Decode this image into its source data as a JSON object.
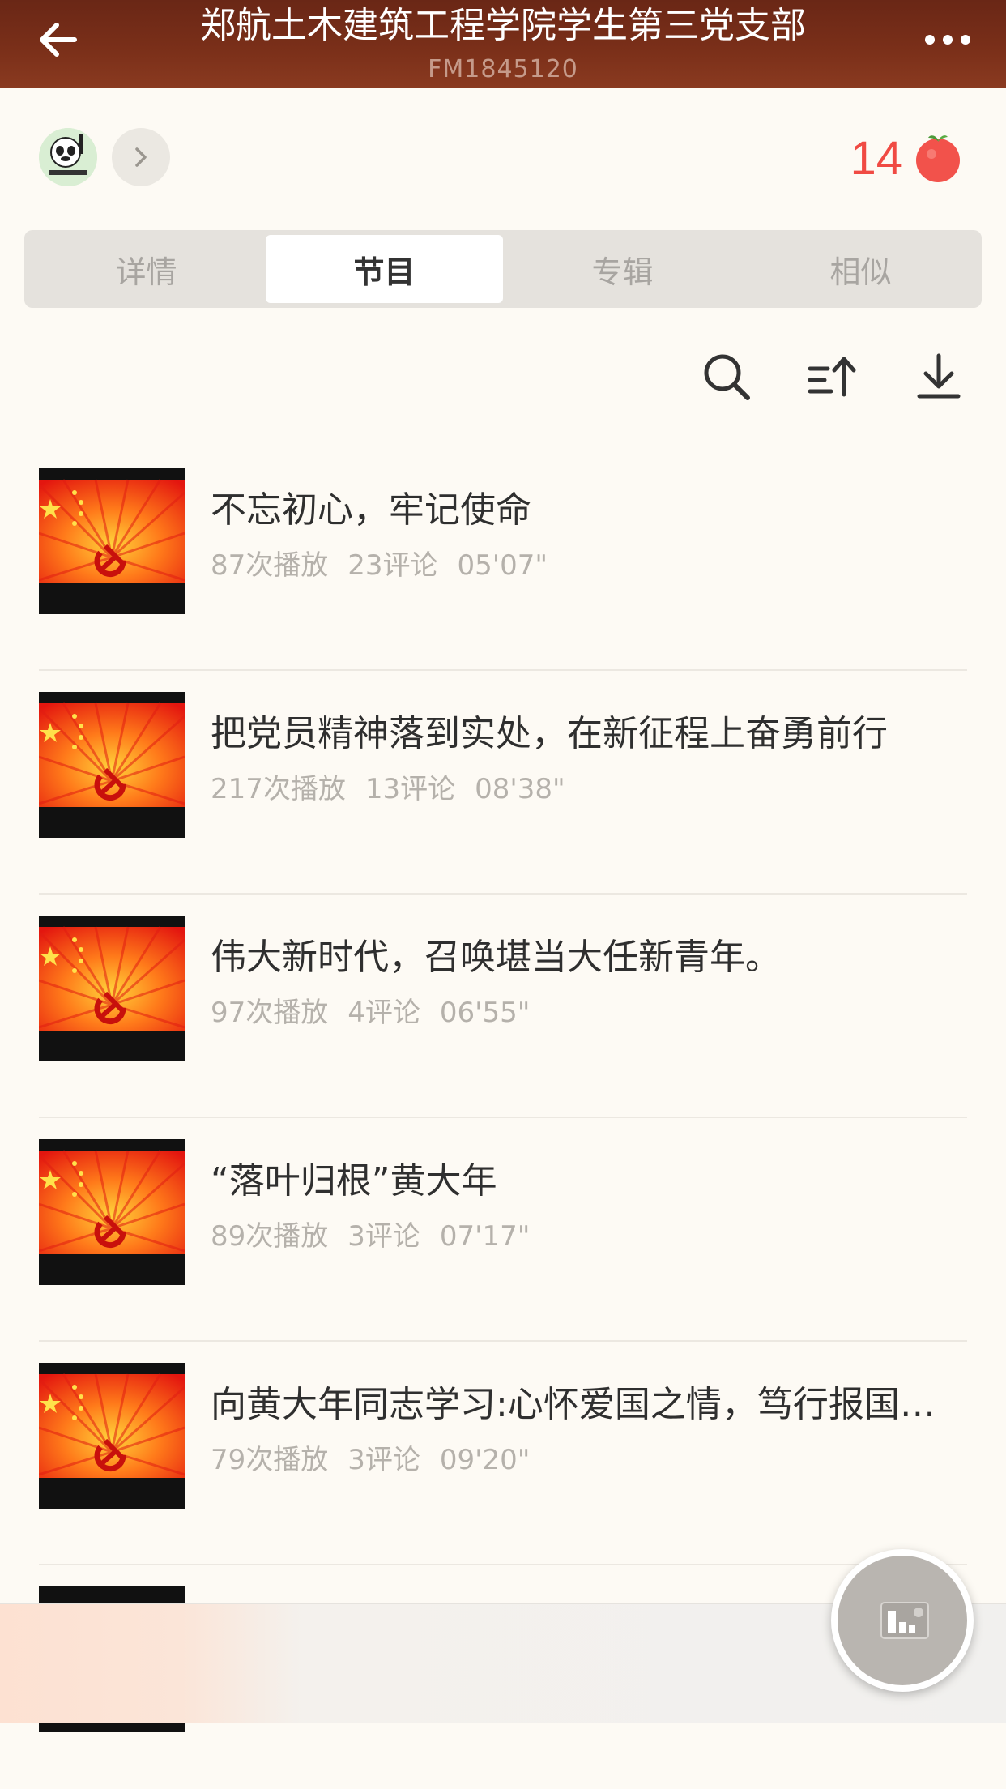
{
  "header": {
    "title": "郑航土木建筑工程学院学生第三党支部",
    "subtitle": "FM1845120",
    "back_icon": "arrow-left-icon",
    "more_icon": "more-dots-icon"
  },
  "profile": {
    "count": "14",
    "count_color": "#f04a43",
    "fruit_icon": "red-fruit-icon"
  },
  "tabs": [
    {
      "label": "详情",
      "active": false
    },
    {
      "label": "节目",
      "active": true
    },
    {
      "label": "专辑",
      "active": false
    },
    {
      "label": "相似",
      "active": false
    }
  ],
  "toolbar": {
    "icons": [
      "search-icon",
      "sort-icon",
      "download-icon"
    ]
  },
  "episodes": [
    {
      "title": "不忘初心，牢记使命",
      "plays": "87次播放",
      "comments": "23评论",
      "duration": "05'07\""
    },
    {
      "title": "把党员精神落到实处，在新征程上奋勇前行",
      "plays": "217次播放",
      "comments": "13评论",
      "duration": "08'38\""
    },
    {
      "title": "伟大新时代，召唤堪当大任新青年。",
      "plays": "97次播放",
      "comments": "4评论",
      "duration": "06'55\""
    },
    {
      "title": "“落叶归根”黄大年",
      "plays": "89次播放",
      "comments": "3评论",
      "duration": "07'17\""
    },
    {
      "title": "向黄大年同志学习:心怀爱国之情，笃行报国之志",
      "plays": "79次播放",
      "comments": "3评论",
      "duration": "09'20\""
    }
  ],
  "colors": {
    "header_bg": "#7a2f19",
    "accent": "#f04a43",
    "page_bg": "#fdfaf4"
  }
}
